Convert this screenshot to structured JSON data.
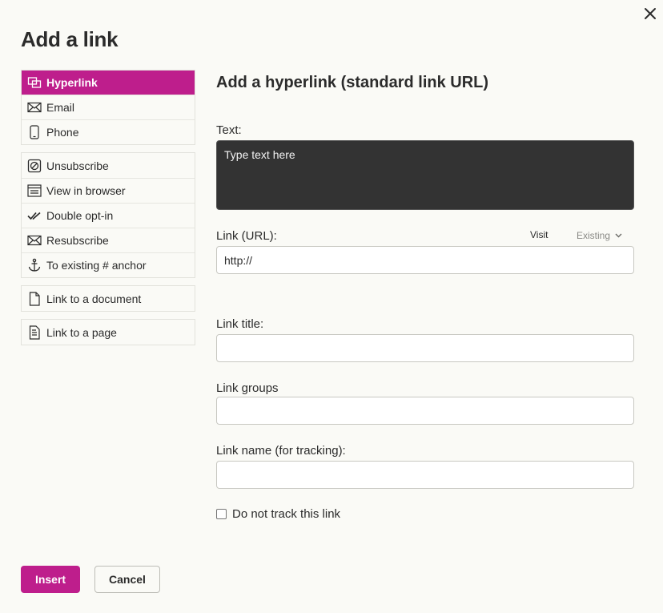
{
  "dialog": {
    "title": "Add a link"
  },
  "sidebar": {
    "groups": [
      [
        {
          "label": "Hyperlink",
          "icon": "hyperlink-icon",
          "active": true
        },
        {
          "label": "Email",
          "icon": "envelope-icon"
        },
        {
          "label": "Phone",
          "icon": "phone-icon"
        }
      ],
      [
        {
          "label": "Unsubscribe",
          "icon": "no-entry-icon"
        },
        {
          "label": "View in browser",
          "icon": "browser-icon"
        },
        {
          "label": "Double opt-in",
          "icon": "double-check-icon"
        },
        {
          "label": "Resubscribe",
          "icon": "envelope-icon"
        },
        {
          "label": "To existing # anchor",
          "icon": "anchor-icon"
        }
      ],
      [
        {
          "label": "Link to a document",
          "icon": "document-icon"
        }
      ],
      [
        {
          "label": "Link to a page",
          "icon": "page-icon"
        }
      ]
    ]
  },
  "main": {
    "heading": "Add a hyperlink (standard link URL)",
    "text_label": "Text:",
    "text_value": "Type text here",
    "url_label": "Link (URL):",
    "url_value": "http://",
    "visit_label": "Visit",
    "existing_label": "Existing",
    "title_label": "Link title:",
    "title_value": "",
    "groups_label": "Link groups",
    "groups_value": "",
    "name_label": "Link name (for tracking):",
    "name_value": "",
    "no_track_label": "Do not track this link",
    "no_track_checked": false
  },
  "footer": {
    "insert_label": "Insert",
    "cancel_label": "Cancel"
  },
  "colors": {
    "accent": "#be1e8c",
    "background": "#fafaf6",
    "textarea_bg": "#333333"
  }
}
